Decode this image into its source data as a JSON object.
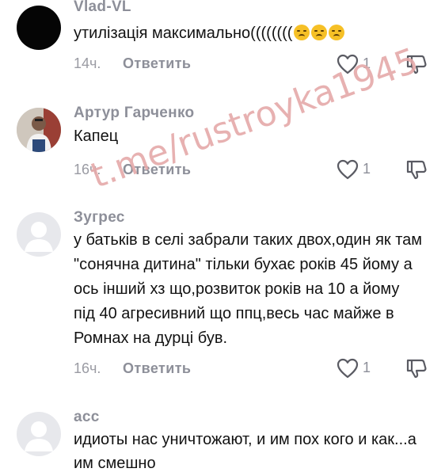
{
  "comments": [
    {
      "author": "Vlad-VL",
      "text": "утилізація максимально((((((((",
      "emojis": [
        "sad-face-emoji",
        "sad-face-emoji",
        "sad-face-emoji"
      ],
      "time": "14ч.",
      "reply": "Ответить",
      "likes": "1"
    },
    {
      "author": "Артур Гарченко",
      "text": "Капец",
      "time": "16ч.",
      "reply": "Ответить",
      "likes": "1"
    },
    {
      "author": "Зугрес",
      "lines": [
        "у батьків в селі забрали таких двох,один як там",
        "\"сонячна дитина\" тільки бухає років 45 йому а",
        "ось інший хз що,розвиток років на 10 а йому",
        "під 40 агресивний що ппц,весь час майже в",
        "Ромнах на дурці був."
      ],
      "time": "16ч.",
      "reply": "Ответить",
      "likes": "1"
    },
    {
      "author": "асс",
      "lines": [
        "идиоты нас уничтожают, и им пох кого и как...а",
        "им смешно"
      ]
    }
  ],
  "watermark": "t.me/rustroyka1945",
  "colors": {
    "meta": "#8d8f99",
    "text": "#121212",
    "emoji": "#f6c026"
  }
}
